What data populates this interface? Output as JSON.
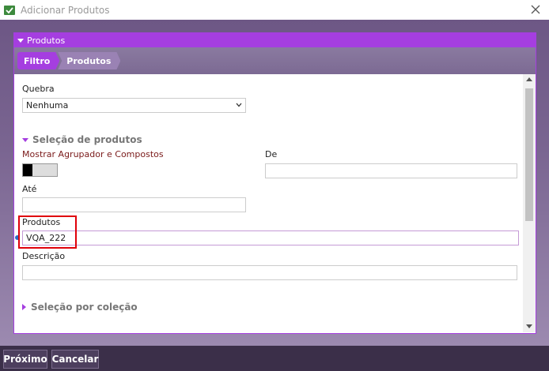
{
  "window": {
    "title": "Adicionar Produtos"
  },
  "panel": {
    "header": "Produtos"
  },
  "breadcrumb": [
    "Filtro",
    "Produtos"
  ],
  "form": {
    "quebra": {
      "label": "Quebra",
      "value": "Nenhuma"
    },
    "selecao_produtos": {
      "title": "Seleção de produtos"
    },
    "mostrar_agrupador": {
      "label": "Mostrar Agrupador e Compostos",
      "checked": false
    },
    "de": {
      "label": "De",
      "value": ""
    },
    "ate": {
      "label": "Até",
      "value": ""
    },
    "produtos": {
      "label": "Produtos",
      "value": "VQA_222"
    },
    "descricao": {
      "label": "Descrição",
      "value": ""
    },
    "selecao_colecao": {
      "title": "Seleção por coleção"
    }
  },
  "footer": {
    "next_label": "Próximo",
    "cancel_label": "Cancelar"
  },
  "colors": {
    "accent": "#a53ee0",
    "highlight": "#e0000a",
    "footer": "#3b2f49"
  }
}
